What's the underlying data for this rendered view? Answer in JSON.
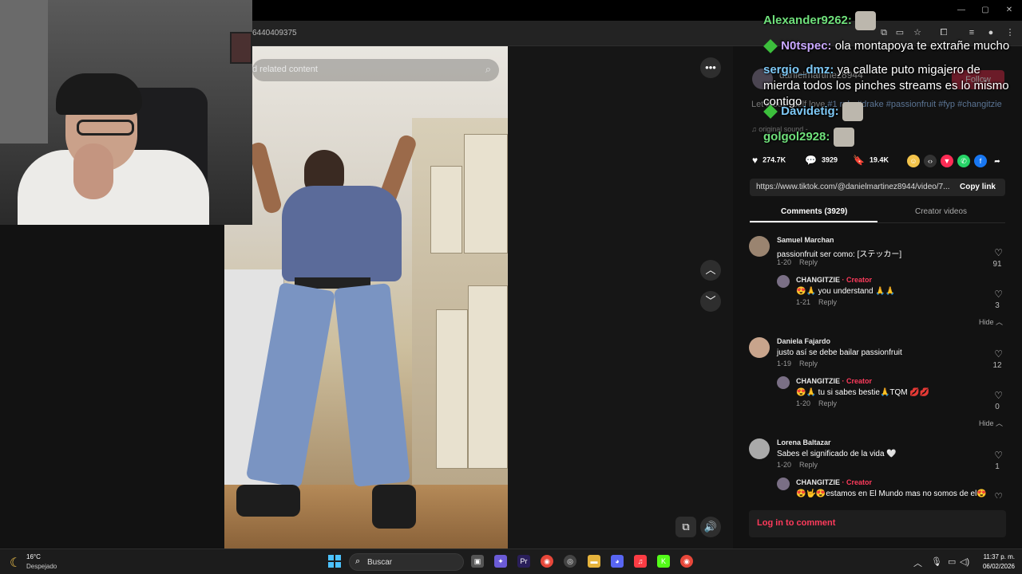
{
  "browser": {
    "url_fragment": "6440409375"
  },
  "video": {
    "search_text": "d related content",
    "more_icon": "ellipsis-icon",
    "up_icon": "chevron-up-icon",
    "down_icon": "chevron-down-icon"
  },
  "author": {
    "name": "danielmartinez8944",
    "follow_label": "Follow"
  },
  "description": {
    "text": "Let it out - self love ",
    "tags": [
      "#1 rule",
      "#drake",
      "#passionfruit",
      "#fyp",
      "#changitzie"
    ],
    "sound": "original sound -"
  },
  "chat": [
    {
      "user": "Alexander9262:",
      "text": "",
      "emote": true,
      "color": "green"
    },
    {
      "user": "N0tspec:",
      "text": "ola montapoya te extrañe mucho",
      "badge": true,
      "color": "purple"
    },
    {
      "user": "sergio_dmz:",
      "text": "ya callate puto migajero de mierda todos los pinches streams es lo mismo contigo",
      "color": "blue"
    },
    {
      "user": "Davidetig:",
      "text": "",
      "badge": true,
      "emote": true,
      "color": "blue"
    },
    {
      "user": "golgol2928:",
      "text": "",
      "emote": true,
      "color": "green"
    }
  ],
  "stats": {
    "likes": "274.7K",
    "comments": "3929",
    "saves": "19.4K"
  },
  "link": {
    "url": "https://www.tiktok.com/@danielmartinez8944/video/7...",
    "copy_label": "Copy link"
  },
  "tabs": {
    "comments": "Comments (3929)",
    "creator": "Creator videos"
  },
  "comments": [
    {
      "name": "Samuel Marchan",
      "text": "passionfruit ser como: [ステッカー]",
      "date": "1-20",
      "reply": "Reply",
      "likes": "91"
    },
    {
      "name": "CHANGITZIE",
      "creator": "· Creator",
      "text": "😍🙏 you understand 🙏🙏",
      "date": "1-21",
      "reply": "Reply",
      "likes": "3"
    },
    {
      "name": "Daniela Fajardo",
      "text": "justo así se debe bailar passionfruit",
      "date": "1-19",
      "reply": "Reply",
      "likes": "12"
    },
    {
      "name": "CHANGITZIE",
      "creator": "· Creator",
      "text": "😍🙏 tu si sabes bestie🙏TQM 💋💋",
      "date": "1-20",
      "reply": "Reply",
      "likes": "0"
    },
    {
      "name": "Lorena Baltazar",
      "text": "Sabes el significado de la vida 🤍",
      "date": "1-20",
      "reply": "Reply",
      "likes": "1"
    },
    {
      "name": "CHANGITZIE",
      "creator": "· Creator",
      "text": "😍🤟😍estamos en El Mundo mas no somos de el😍",
      "date": "",
      "reply": "",
      "likes": ""
    }
  ],
  "hide_label": "Hide",
  "login_label": "Log in to comment",
  "taskbar": {
    "temp": "16°C",
    "condition": "Despejado",
    "search_placeholder": "Buscar",
    "time": "11:37 p. m.",
    "date": "06/02/2026"
  }
}
